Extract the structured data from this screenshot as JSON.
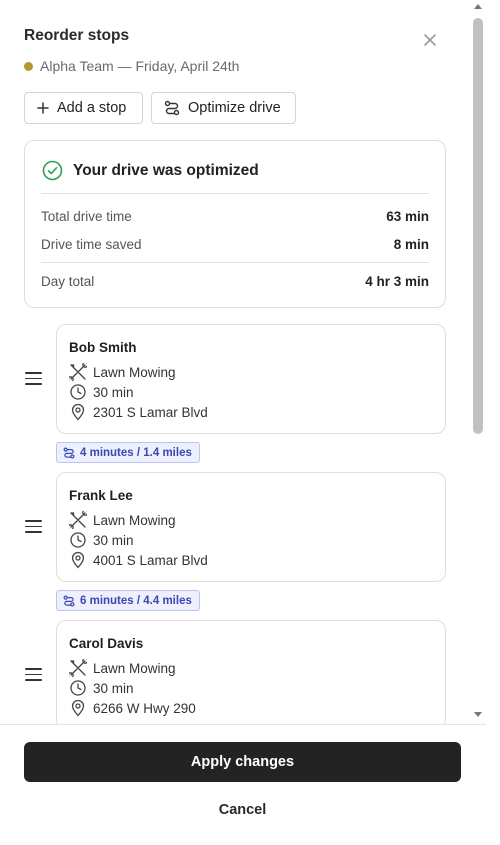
{
  "header": {
    "title": "Reorder stops",
    "subtitle": "Alpha Team — Friday, April 24th",
    "team_color": "#b8962e"
  },
  "toolbar": {
    "add_stop_label": "Add a stop",
    "optimize_label": "Optimize drive"
  },
  "optimization": {
    "heading": "Your drive was optimized",
    "stats": [
      {
        "label": "Total drive time",
        "value": "63 min"
      },
      {
        "label": "Drive time saved",
        "value": "8 min"
      },
      {
        "label": "Day total",
        "value": "4 hr 3 min"
      }
    ]
  },
  "stops": [
    {
      "name": "Bob Smith",
      "service": "Lawn Mowing",
      "duration": "30 min",
      "address": "2301 S Lamar Blvd"
    },
    {
      "name": "Frank Lee",
      "service": "Lawn Mowing",
      "duration": "30 min",
      "address": "4001 S Lamar Blvd"
    },
    {
      "name": "Carol Davis",
      "service": "Lawn Mowing",
      "duration": "30 min",
      "address": "6266 W Hwy 290"
    }
  ],
  "drives": [
    {
      "label": "4 minutes / 1.4 miles"
    },
    {
      "label": "6 minutes / 4.4 miles"
    }
  ],
  "footer": {
    "apply_label": "Apply changes",
    "cancel_label": "Cancel"
  },
  "colors": {
    "success": "#2e9e5b",
    "drive_badge_text": "#3a47b3",
    "drive_badge_bg": "#eef1fd",
    "primary_button": "#232323"
  }
}
